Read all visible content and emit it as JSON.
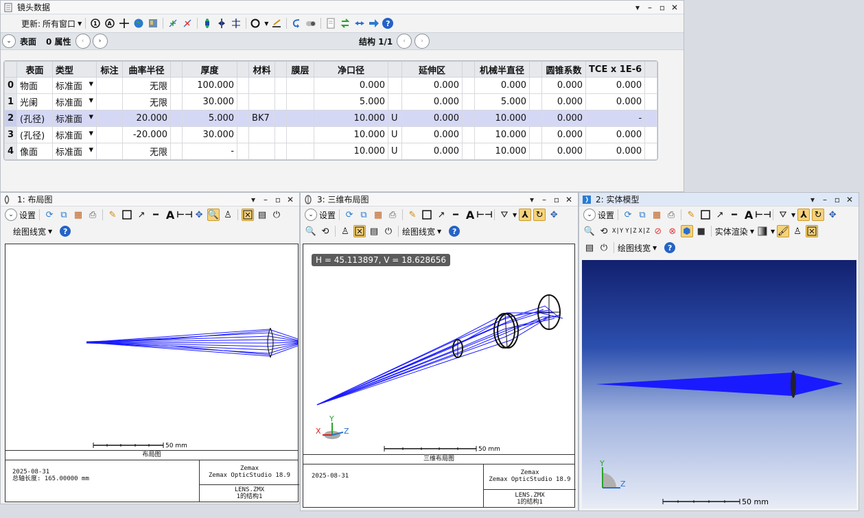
{
  "lens_window": {
    "title": "镜头数据",
    "update_label": "更新:",
    "update_value": "所有窗口",
    "surface_label": "表面",
    "properties_label": "0 属性",
    "config_label": "结构 1/1",
    "columns": [
      "表面",
      "类型",
      "标注",
      "曲率半径",
      "厚度",
      "材料",
      "膜层",
      "净口径",
      "延伸区",
      "机械半直径",
      "圆锥系数",
      "TCE x 1E-6"
    ],
    "rows": [
      {
        "idx": "0",
        "surface": "物面",
        "type": "标准面",
        "comment": "",
        "radius": "无限",
        "thickness": "100.000",
        "material": "",
        "coating": "",
        "clear": "0.000",
        "clear_flag": "",
        "chip": "0.000",
        "mech": "0.000",
        "conic": "0.000",
        "tce": "0.000"
      },
      {
        "idx": "1",
        "surface": "光阑",
        "type": "标准面",
        "comment": "",
        "radius": "无限",
        "thickness": "30.000",
        "material": "",
        "coating": "",
        "clear": "5.000",
        "clear_flag": "",
        "chip": "0.000",
        "mech": "5.000",
        "conic": "0.000",
        "tce": "0.000"
      },
      {
        "idx": "2",
        "surface": "(孔径)",
        "type": "标准面",
        "comment": "",
        "radius": "20.000",
        "thickness": "5.000",
        "material": "BK7",
        "coating": "",
        "clear": "10.000",
        "clear_flag": "U",
        "chip": "0.000",
        "mech": "10.000",
        "conic": "0.000",
        "tce": "-"
      },
      {
        "idx": "3",
        "surface": "(孔径)",
        "type": "标准面",
        "comment": "",
        "radius": "-20.000",
        "thickness": "30.000",
        "material": "",
        "coating": "",
        "clear": "10.000",
        "clear_flag": "U",
        "chip": "0.000",
        "mech": "10.000",
        "conic": "0.000",
        "tce": "0.000"
      },
      {
        "idx": "4",
        "surface": "像面",
        "type": "标准面",
        "comment": "",
        "radius": "无限",
        "thickness": "-",
        "material": "",
        "coating": "",
        "clear": "10.000",
        "clear_flag": "U",
        "chip": "0.000",
        "mech": "10.000",
        "conic": "0.000",
        "tce": "0.000"
      }
    ]
  },
  "layout_window": {
    "title": "1: 布局图",
    "settings_label": "设置",
    "linewidth_label": "绘图线宽",
    "scale_label": "50 mm",
    "caption": "布局图",
    "date": "2025-08-31",
    "axis_length": "总轴长度:  165.00000 mm",
    "company": "Zemax",
    "product": "Zemax OpticStudio 18.9",
    "file": "LENS.ZMX",
    "config": "1的结构1"
  },
  "layout3d_window": {
    "title": "3: 三维布局图",
    "settings_label": "设置",
    "linewidth_label": "绘图线宽",
    "tooltip": "H = 45.113897, V = 18.628656",
    "scale_label": "50 mm",
    "caption": "三维布局图",
    "date": "2025-08-31",
    "company": "Zemax",
    "product": "Zemax OpticStudio 18.9",
    "file": "LENS.ZMX",
    "config": "1的结构1",
    "axis_x": "X",
    "axis_y": "Y",
    "axis_z": "Z"
  },
  "solid_window": {
    "title": "2: 实体模型",
    "settings_label": "设置",
    "render_label": "实体渲染",
    "linewidth_label": "绘图线宽",
    "xy": "X|Y",
    "yz": "Y|Z",
    "xz": "X|Z",
    "scale_label": "50 mm",
    "axis_y": "Y",
    "axis_z": "Z"
  },
  "colors": {
    "ray": "#1a1aff",
    "accent": "#f6d27a",
    "solid_bg_top": "#12206e",
    "solid_bg_bottom": "#e8ecf6"
  }
}
